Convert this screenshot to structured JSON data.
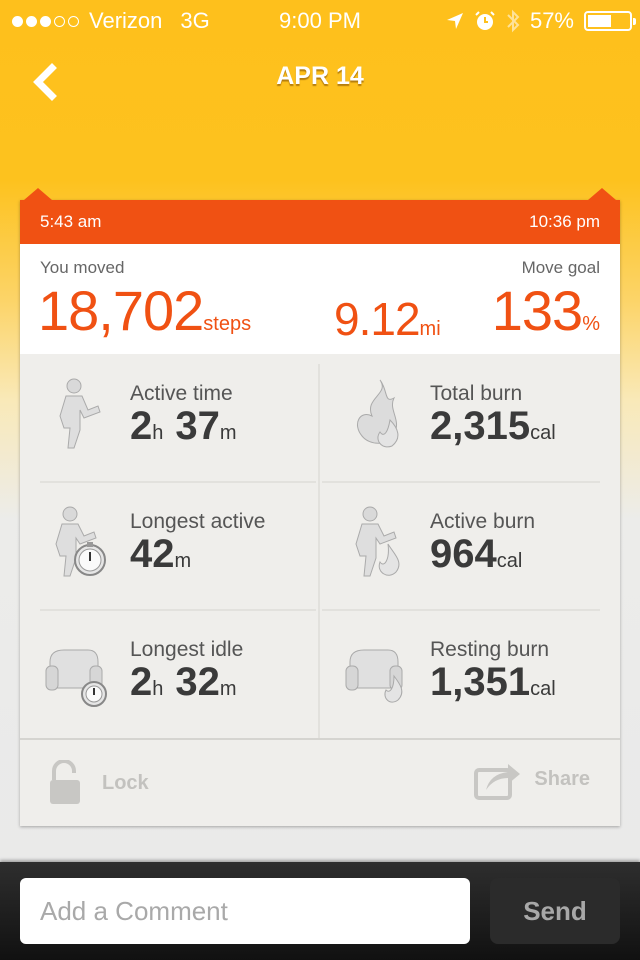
{
  "status_bar": {
    "signal_bars_filled": 3,
    "signal_bars_total": 5,
    "carrier": "Verizon",
    "network": "3G",
    "time": "9:00 PM",
    "battery_percent": "57%",
    "battery_level": 0.57
  },
  "nav": {
    "title": "APR 14",
    "back_icon": "chevron-left-icon"
  },
  "card": {
    "start_time": "5:43 am",
    "end_time": "10:36 pm",
    "summary": {
      "moved_label": "You moved",
      "goal_label": "Move goal",
      "steps_value": "18,702",
      "steps_unit": "steps",
      "distance_value": "9.12",
      "distance_unit": "mi",
      "goal_value": "133",
      "goal_unit": "%"
    },
    "stats": [
      {
        "title": "Active time",
        "icon": "running-person-icon",
        "parts": [
          {
            "v": "2",
            "u": "h"
          },
          {
            "v": "37",
            "u": "m"
          }
        ]
      },
      {
        "title": "Total burn",
        "icon": "flames-icon",
        "parts": [
          {
            "v": "2,315",
            "u": "cal"
          }
        ]
      },
      {
        "title": "Longest active",
        "icon": "running-person-stopwatch-icon",
        "parts": [
          {
            "v": "42",
            "u": "m"
          }
        ]
      },
      {
        "title": "Active burn",
        "icon": "running-person-flame-icon",
        "parts": [
          {
            "v": "964",
            "u": "cal"
          }
        ]
      },
      {
        "title": "Longest idle",
        "icon": "armchair-stopwatch-icon",
        "parts": [
          {
            "v": "2",
            "u": "h"
          },
          {
            "v": "32",
            "u": "m"
          }
        ]
      },
      {
        "title": "Resting burn",
        "icon": "armchair-flame-icon",
        "parts": [
          {
            "v": "1,351",
            "u": "cal"
          }
        ]
      }
    ],
    "actions": {
      "lock_label": "Lock",
      "share_label": "Share"
    }
  },
  "comment": {
    "placeholder": "Add a Comment",
    "value": "",
    "send_label": "Send"
  },
  "colors": {
    "header_yellow": "#fec01c",
    "accent_orange": "#f05113",
    "card_bg": "#efeeeb"
  }
}
